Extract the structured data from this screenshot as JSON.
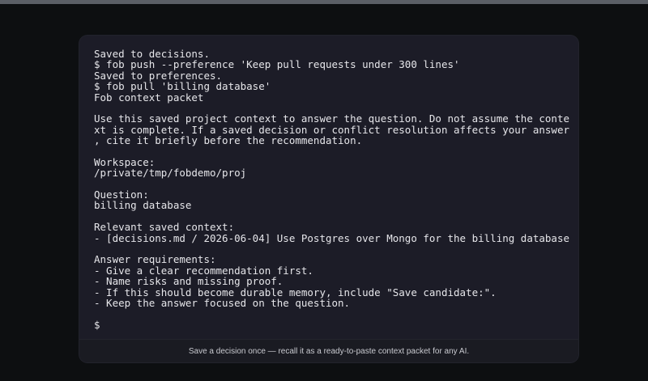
{
  "terminal": {
    "lines": [
      "Saved to decisions.",
      "$ fob push --preference 'Keep pull requests under 300 lines'",
      "Saved to preferences.",
      "$ fob pull 'billing database'",
      "Fob context packet",
      "",
      "Use this saved project context to answer the question. Do not assume the conte",
      "xt is complete. If a saved decision or conflict resolution affects your answer",
      ", cite it briefly before the recommendation.",
      "",
      "Workspace:",
      "/private/tmp/fobdemo/proj",
      "",
      "Question:",
      "billing database",
      "",
      "Relevant saved context:",
      "- [decisions.md / 2026-06-04] Use Postgres over Mongo for the billing database",
      "",
      "Answer requirements:",
      "- Give a clear recommendation first.",
      "- Name risks and missing proof.",
      "- If this should become durable memory, include \"Save candidate:\".",
      "- Keep the answer focused on the question.",
      "",
      "$"
    ]
  },
  "caption": {
    "text": "Save a decision once — recall it as a ready-to-paste context packet for any AI."
  }
}
